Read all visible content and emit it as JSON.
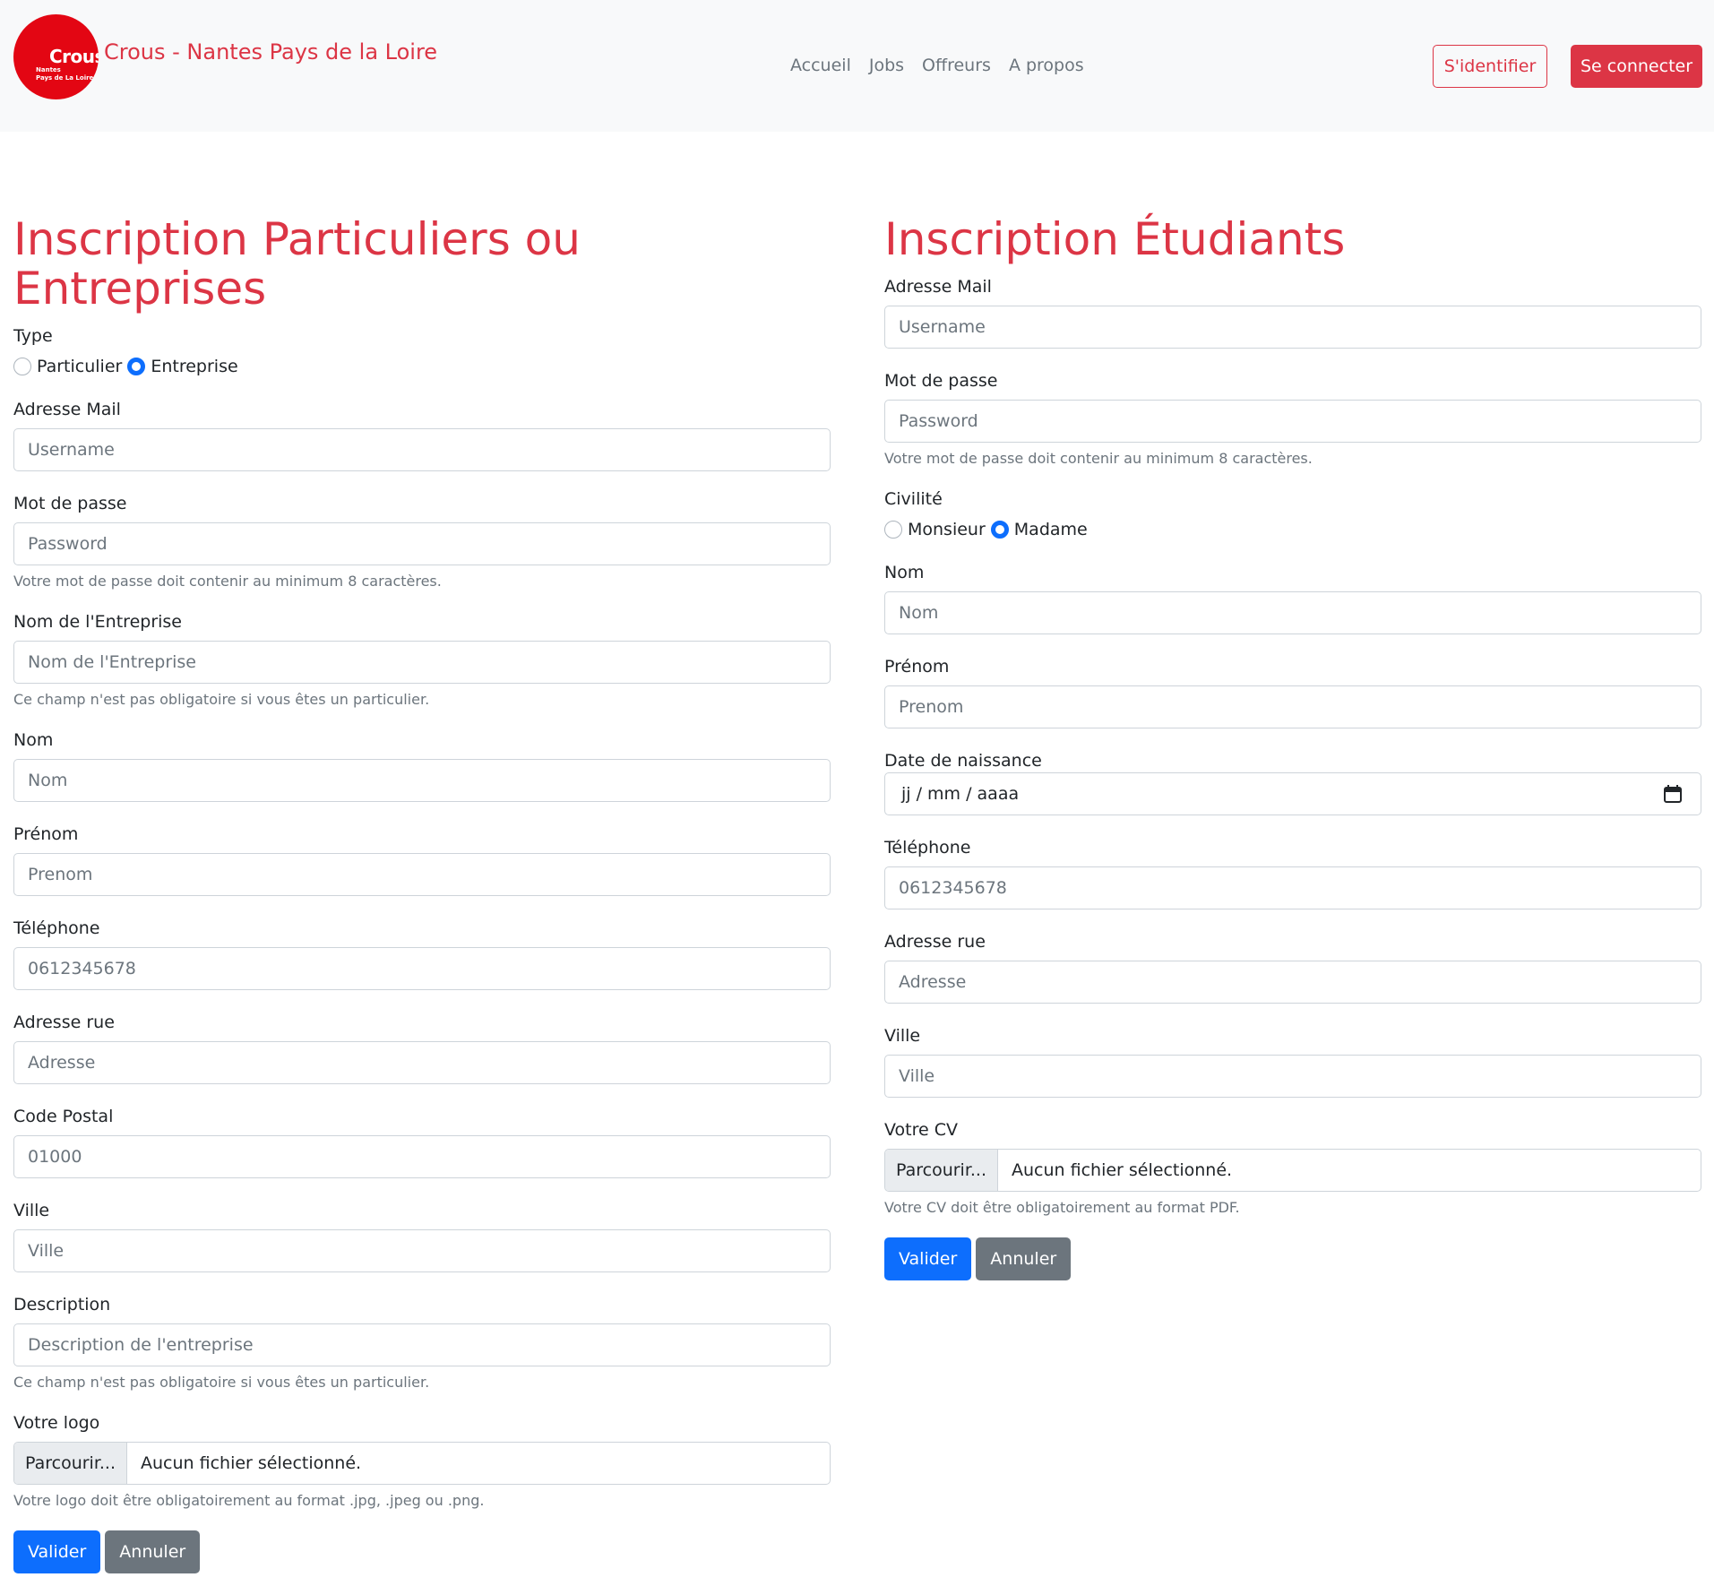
{
  "navbar": {
    "logo": {
      "text": "Crous",
      "sub1": "Nantes",
      "sub2": "Pays de La Loire"
    },
    "brand_title": "Crous - Nantes Pays de la Loire",
    "links": [
      "Accueil",
      "Jobs",
      "Offreurs",
      "A propos"
    ],
    "identify_label": "S'identifier",
    "connect_label": "Se connecter",
    "colors": {
      "accent": "#dc3545",
      "bg": "#f8f9fa"
    }
  },
  "company_form": {
    "title": "Inscription Particuliers ou Entreprises",
    "type_label": "Type",
    "type_options": {
      "particulier": "Particulier",
      "entreprise": "Entreprise",
      "selected": "Entreprise"
    },
    "email": {
      "label": "Adresse Mail",
      "placeholder": "Username"
    },
    "password": {
      "label": "Mot de passe",
      "placeholder": "Password",
      "help": "Votre mot de passe doit contenir au minimum 8 caractères."
    },
    "company_name": {
      "label": "Nom de l'Entreprise",
      "placeholder": "Nom de l'Entreprise",
      "help": "Ce champ n'est pas obligatoire si vous êtes un particulier."
    },
    "lastname": {
      "label": "Nom",
      "placeholder": "Nom"
    },
    "firstname": {
      "label": "Prénom",
      "placeholder": "Prenom"
    },
    "phone": {
      "label": "Téléphone",
      "placeholder": "0612345678"
    },
    "street": {
      "label": "Adresse rue",
      "placeholder": "Adresse"
    },
    "zip": {
      "label": "Code Postal",
      "placeholder": "01000"
    },
    "city": {
      "label": "Ville",
      "placeholder": "Ville"
    },
    "description": {
      "label": "Description",
      "placeholder": "Description de l'entreprise",
      "help": "Ce champ n'est pas obligatoire si vous êtes un particulier."
    },
    "logo": {
      "label": "Votre logo",
      "button": "Parcourir...",
      "status": "Aucun fichier sélectionné.",
      "help": "Votre logo doit être obligatoirement au format .jpg, .jpeg ou .png."
    },
    "submit_label": "Valider",
    "cancel_label": "Annuler"
  },
  "student_form": {
    "title": "Inscription Étudiants",
    "email": {
      "label": "Adresse Mail",
      "placeholder": "Username"
    },
    "password": {
      "label": "Mot de passe",
      "placeholder": "Password",
      "help": "Votre mot de passe doit contenir au minimum 8 caractères."
    },
    "civility_label": "Civilité",
    "civility_options": {
      "monsieur": "Monsieur",
      "madame": "Madame",
      "selected": "Madame"
    },
    "lastname": {
      "label": "Nom",
      "placeholder": "Nom"
    },
    "firstname": {
      "label": "Prénom",
      "placeholder": "Prenom"
    },
    "birthdate": {
      "label": "Date de naissance",
      "value": "jj / mm / aaaa"
    },
    "phone": {
      "label": "Téléphone",
      "placeholder": "0612345678"
    },
    "street": {
      "label": "Adresse rue",
      "placeholder": "Adresse"
    },
    "city": {
      "label": "Ville",
      "placeholder": "Ville"
    },
    "cv": {
      "label": "Votre CV",
      "button": "Parcourir...",
      "status": "Aucun fichier sélectionné.",
      "help": "Votre CV doit être obligatoirement au format PDF."
    },
    "submit_label": "Valider",
    "cancel_label": "Annuler"
  }
}
